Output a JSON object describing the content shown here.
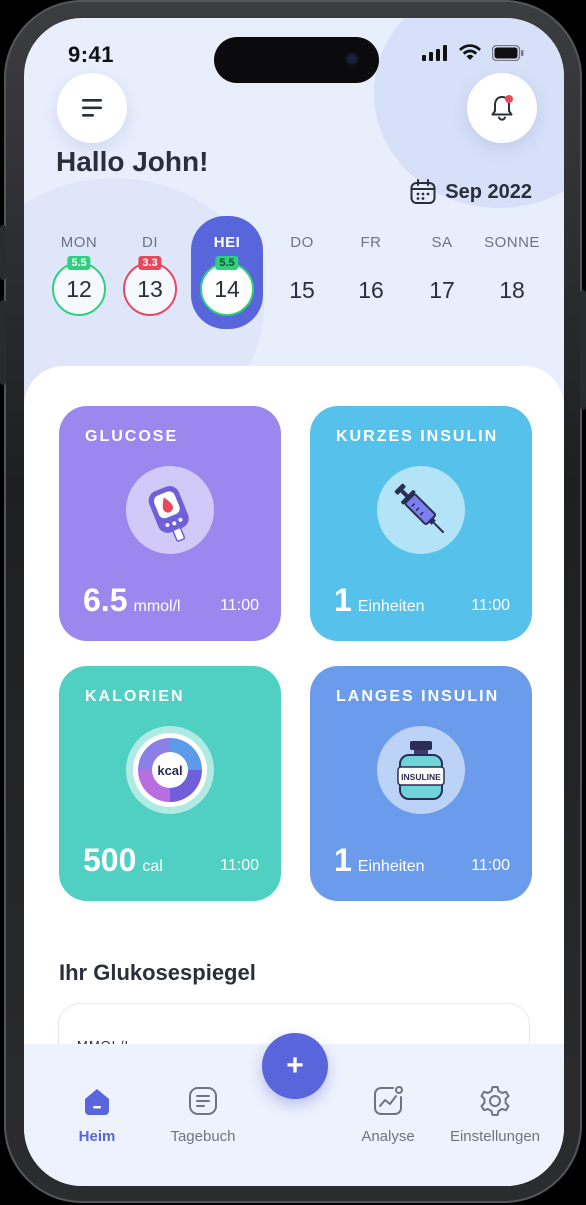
{
  "status_bar": {
    "time": "9:41"
  },
  "header": {
    "greeting": "Hallo John!",
    "month": "Sep 2022"
  },
  "week": [
    {
      "name": "MON",
      "num": "12",
      "badge": "5.5",
      "badge_color": "#2ecf7f",
      "ring_color": "#2ecf7f",
      "active": false
    },
    {
      "name": "DI",
      "num": "13",
      "badge": "3.3",
      "badge_color": "#e8485d",
      "ring_color": "#e8485d",
      "active": false
    },
    {
      "name": "HEI",
      "num": "14",
      "badge": "5.5",
      "badge_color": "#2ecf7f",
      "ring_color": "#2ecf7f",
      "active": true
    },
    {
      "name": "DO",
      "num": "15",
      "badge": "",
      "active": false
    },
    {
      "name": "FR",
      "num": "16",
      "badge": "",
      "active": false
    },
    {
      "name": "SA",
      "num": "17",
      "badge": "",
      "active": false
    },
    {
      "name": "SONNE",
      "num": "18",
      "badge": "",
      "active": false
    }
  ],
  "cards": {
    "glucose": {
      "title": "GLUCOSE",
      "value": "6.5",
      "unit": "mmol/l",
      "time": "11:00",
      "color": "#9a88ef",
      "icon": "glucose-meter-icon"
    },
    "short_insulin": {
      "title": "KURZES INSULIN",
      "value": "1",
      "unit": "Einheiten",
      "time": "11:00",
      "color": "#56c1ea",
      "icon": "syringe-icon"
    },
    "calories": {
      "title": "KALORIEN",
      "value": "500",
      "unit": "cal",
      "time": "11:00",
      "color": "#4fd0c2",
      "icon": "kcal-icon",
      "icon_text": "kcal"
    },
    "long_insulin": {
      "title": "LANGES INSULIN",
      "value": "1",
      "unit": "Einheiten",
      "time": "11:00",
      "color": "#6b9cec",
      "icon": "insulin-bottle-icon",
      "icon_text": "INSULINE"
    }
  },
  "glucose_section": {
    "title": "Ihr Glukosespiegel",
    "unit_label": "MMOL/L"
  },
  "tabbar": {
    "home": "Heim",
    "diary": "Tagebuch",
    "add": "+",
    "analysis": "Analyse",
    "settings": "Einstellungen"
  },
  "colors": {
    "accent": "#5865db",
    "notification_dot": "#e8485d"
  }
}
